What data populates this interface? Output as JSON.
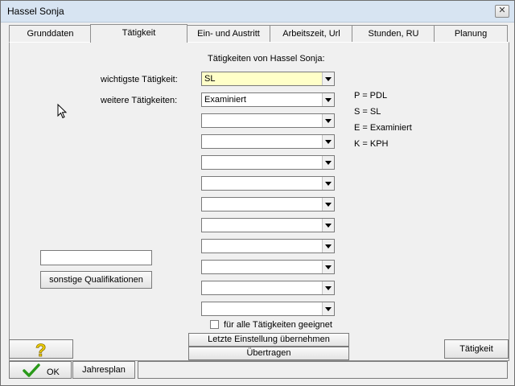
{
  "window": {
    "title": "Hassel Sonja",
    "close_glyph": "✕"
  },
  "tabs": [
    {
      "label": "Grunddaten",
      "active": false
    },
    {
      "label": "Tätigkeit",
      "active": true
    },
    {
      "label": "Ein- und Austritt",
      "active": false
    },
    {
      "label": "Arbeitszeit, Url",
      "active": false
    },
    {
      "label": "Stunden, RU",
      "active": false
    },
    {
      "label": "Planung",
      "active": false
    }
  ],
  "main": {
    "heading": "Tätigkeiten von Hassel Sonja:",
    "primary_label": "wichtigste Tätigkeit:",
    "primary_value": "SL",
    "further_label": "weitere Tätigkeiten:",
    "further_values": [
      "Examiniert",
      "",
      "",
      "",
      "",
      "",
      "",
      "",
      "",
      "",
      ""
    ],
    "legend": [
      "P = PDL",
      "S = SL",
      "E = Examiniert",
      "K = KPH"
    ],
    "checkbox_label": "für alle Tätigkeiten geeignet",
    "checkbox_checked": false,
    "btn_last_setting": "Letzte Einstellung übernehmen",
    "btn_transfer": "Übertragen",
    "other_qual_value": "",
    "btn_other_qual": "sonstige Qualifikationen"
  },
  "footer": {
    "help_icon": "question-mark",
    "btn_ok": "OK",
    "btn_yearplan": "Jahresplan",
    "btn_activity": "Tätigkeit",
    "status_text": ""
  },
  "colors": {
    "highlight_field": "#ffffc8",
    "ok_check": "#2a9a1a",
    "help_icon": "#f0d000"
  }
}
